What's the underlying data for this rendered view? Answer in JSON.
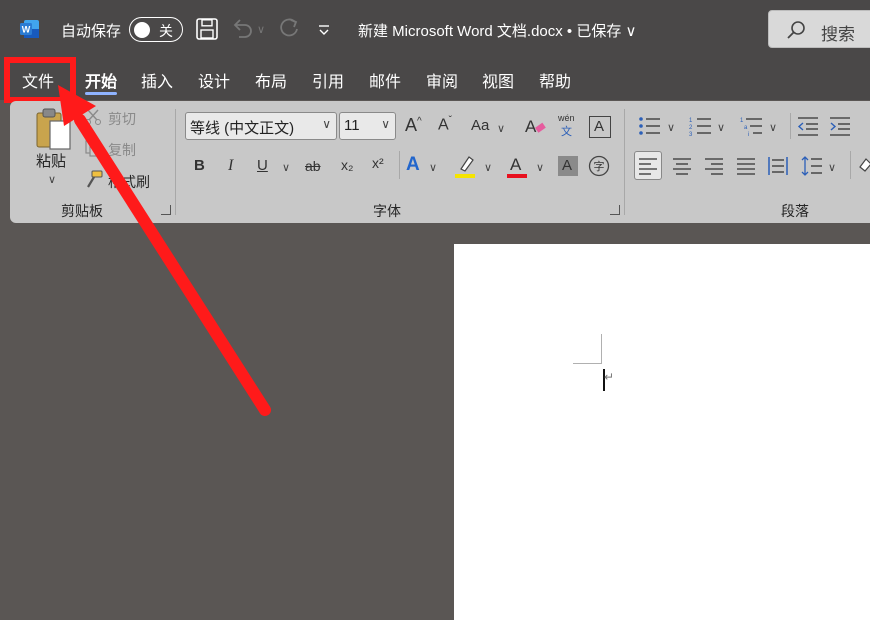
{
  "titlebar": {
    "app_icon": "word-logo-icon",
    "autosave_label": "自动保存",
    "autosave_state": "关",
    "document_title": "新建 Microsoft Word 文档.docx • 已保存 ∨",
    "search_placeholder": "搜索"
  },
  "tabs": [
    {
      "label": "文件"
    },
    {
      "label": "开始",
      "active": true
    },
    {
      "label": "插入"
    },
    {
      "label": "设计"
    },
    {
      "label": "布局"
    },
    {
      "label": "引用"
    },
    {
      "label": "邮件"
    },
    {
      "label": "审阅"
    },
    {
      "label": "视图"
    },
    {
      "label": "帮助"
    }
  ],
  "ribbon": {
    "clipboard": {
      "paste_label": "粘贴",
      "cut_label": "剪切",
      "copy_label": "复制",
      "format_painter_label": "格式刷",
      "group_label": "剪贴板"
    },
    "font": {
      "font_name": "等线 (中文正文)",
      "font_size": "11",
      "bold": "B",
      "italic": "I",
      "underline": "U",
      "strike": "ab",
      "subscript": "x₂",
      "superscript": "x²",
      "clear_case": "Aa",
      "phonetic_top": "wén",
      "phonetic_bottom": "文",
      "group_label": "字体",
      "highlight_color": "#f5e400",
      "font_color": "#e8101e"
    },
    "paragraph": {
      "group_label": "段落"
    }
  },
  "colors": {
    "accent": "#8fb3ff",
    "annotation": "#ff1a1a"
  }
}
